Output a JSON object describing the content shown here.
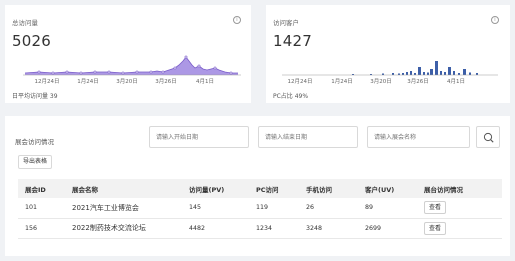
{
  "visits_card": {
    "label": "总访问量",
    "value": "5026",
    "footer": "日平均访问量 39",
    "info": "i",
    "x_ticks": [
      "12月24日",
      "1月24日",
      "3月20日",
      "3月26日",
      "4月1日"
    ]
  },
  "customers_card": {
    "label": "访问客户",
    "value": "1427",
    "footer": "PC占比 49%",
    "info": "i",
    "x_ticks": [
      "12月24日",
      "1月24日",
      "3月20日",
      "3月26日",
      "4月1日"
    ]
  },
  "panel": {
    "title": "展会访问情况",
    "start_placeholder": "请输入开始日期",
    "end_placeholder": "请输入结束日期",
    "name_placeholder": "请输入展会名称",
    "export_label": "导出表格"
  },
  "table": {
    "headers": [
      "展会ID",
      "展会名称",
      "访问量(PV)",
      "PC访问",
      "手机访问",
      "客户(UV)",
      "展台访问情况"
    ],
    "rows": [
      {
        "id": "101",
        "name": "2021汽车工业博览会",
        "pv": "145",
        "pc": "119",
        "mobile": "26",
        "uv": "89",
        "action": "查看"
      },
      {
        "id": "156",
        "name": "2022制药技术交流论坛",
        "pv": "4482",
        "pc": "1234",
        "mobile": "3248",
        "uv": "2699",
        "action": "查看"
      }
    ]
  },
  "colors": {
    "accent": "#8e6fd8",
    "area_fill": "#9d86e0",
    "bar": "#3d5fa8"
  }
}
